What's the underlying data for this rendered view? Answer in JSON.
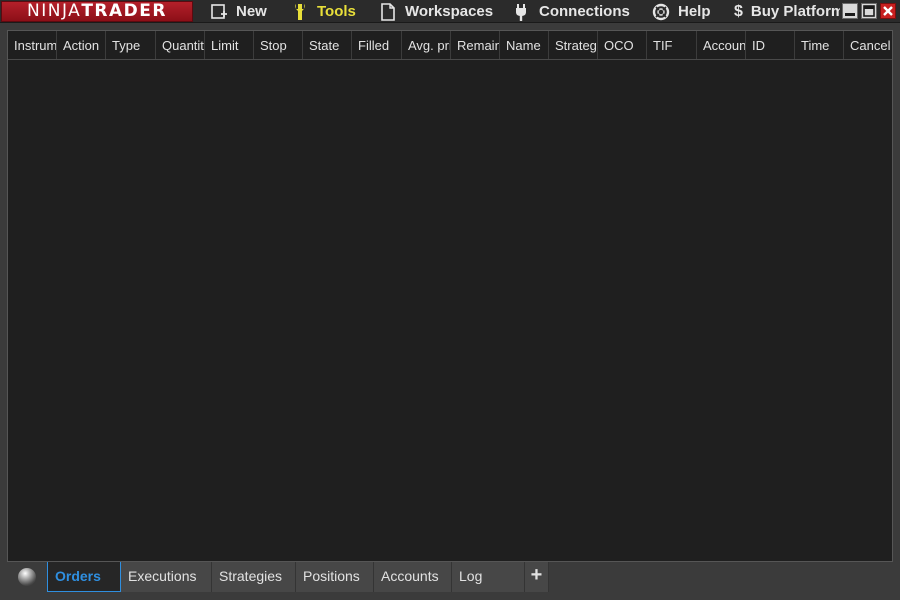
{
  "app": {
    "logo_part1": "NINJA",
    "logo_part2": "TRADER"
  },
  "menu": {
    "items": [
      {
        "label": "New",
        "icon": "new-window-icon"
      },
      {
        "label": "Tools",
        "icon": "wrench-icon",
        "active": true
      },
      {
        "label": "Workspaces",
        "icon": "document-icon"
      },
      {
        "label": "Connections",
        "icon": "plug-icon"
      },
      {
        "label": "Help",
        "icon": "lifebuoy-icon"
      },
      {
        "label": "Buy Platform",
        "icon": "dollar-icon"
      }
    ],
    "dollar_glyph": "$"
  },
  "window_controls": [
    "minimize-icon",
    "maximize-icon",
    "close-icon"
  ],
  "orders_grid": {
    "columns": [
      "Instrument",
      "Action",
      "Type",
      "Quantity",
      "Limit",
      "Stop",
      "State",
      "Filled",
      "Avg. price",
      "Remaining",
      "Name",
      "Strategy",
      "OCO",
      "TIF",
      "Account",
      "ID",
      "Time",
      "Cancel"
    ],
    "rows": []
  },
  "tabs": {
    "items": [
      "Orders",
      "Executions",
      "Strategies",
      "Positions",
      "Accounts",
      "Log"
    ],
    "active": "Orders",
    "add_label": "+"
  },
  "colors": {
    "accent_tab": "#2f8fe0",
    "active_menu": "#e8df3a",
    "logo_red": "#a51722",
    "grid_bg": "#1f1f1f"
  }
}
